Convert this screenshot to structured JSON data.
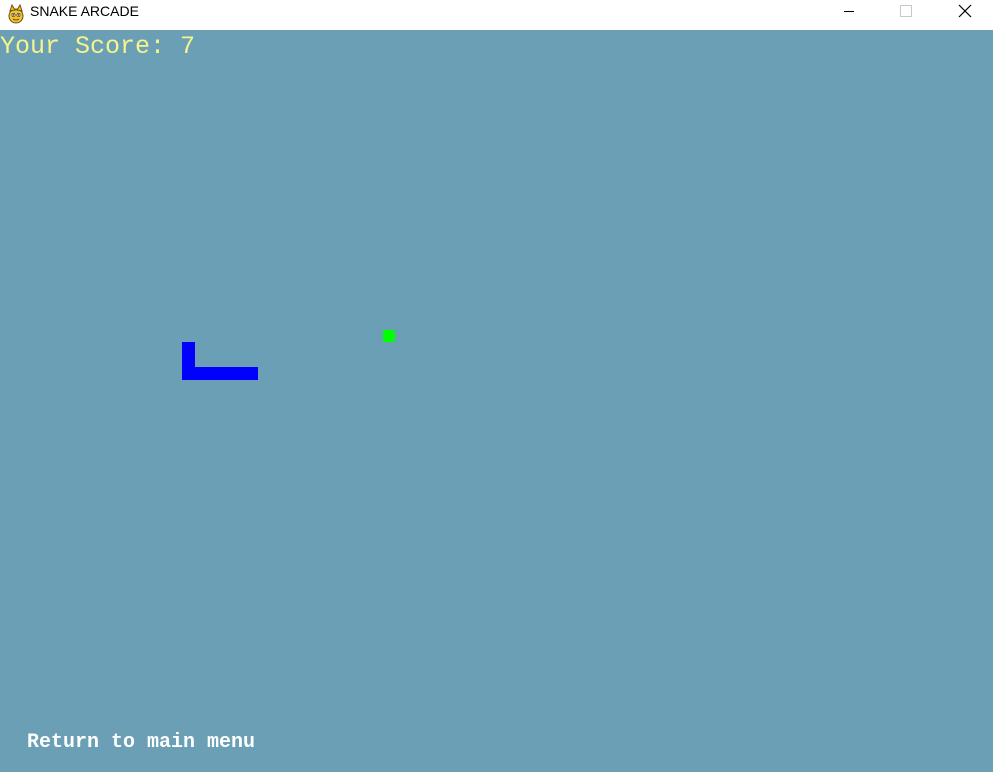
{
  "window": {
    "title": "SNAKE ARCADE",
    "app_icon": "pygame-snake-icon",
    "controls": {
      "minimize_icon": "minimize-icon",
      "maximize_icon": "maximize-icon",
      "close_icon": "close-icon"
    }
  },
  "game": {
    "score_text": "Your Score: 7",
    "score_value": 7,
    "menu_link_text": "Return to main menu",
    "colors": {
      "background": "#6a9fb5",
      "score_text": "#f5f58c",
      "snake": "#0000ff",
      "food": "#00ff00",
      "menu_text": "#ffffff"
    }
  }
}
